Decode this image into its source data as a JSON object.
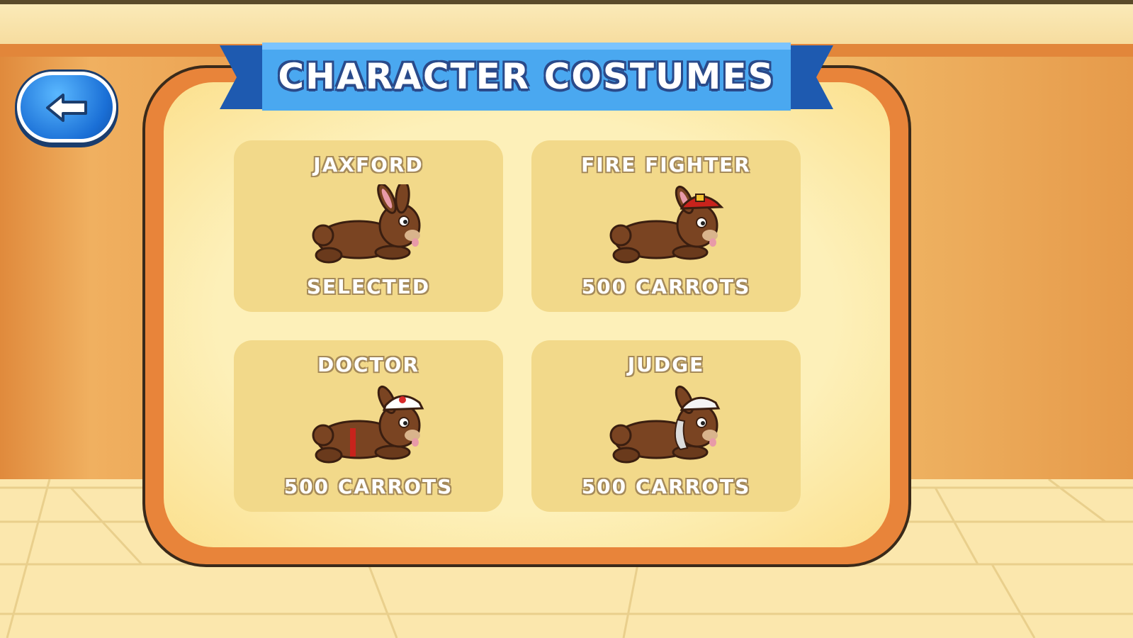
{
  "screen": {
    "title": "CHARACTER COSTUMES",
    "back_icon": "left-arrow-icon"
  },
  "costumes": [
    {
      "name": "JAXFORD",
      "status": "SELECTED",
      "selected": true,
      "accessory": "none"
    },
    {
      "name": "FIRE FIGHTER",
      "status": "500 CARROTS",
      "selected": false,
      "accessory": "red-helmet"
    },
    {
      "name": "DOCTOR",
      "status": "500 CARROTS",
      "selected": false,
      "accessory": "white-nurse-cap"
    },
    {
      "name": "JUDGE",
      "status": "500 CARROTS",
      "selected": false,
      "accessory": "white-wig"
    }
  ],
  "colors": {
    "banner": "#4aa8f0",
    "banner_dark": "#1e5ab0",
    "panel_border": "#e8843a",
    "card": "#f2d98a",
    "bunny": "#7a4422"
  }
}
